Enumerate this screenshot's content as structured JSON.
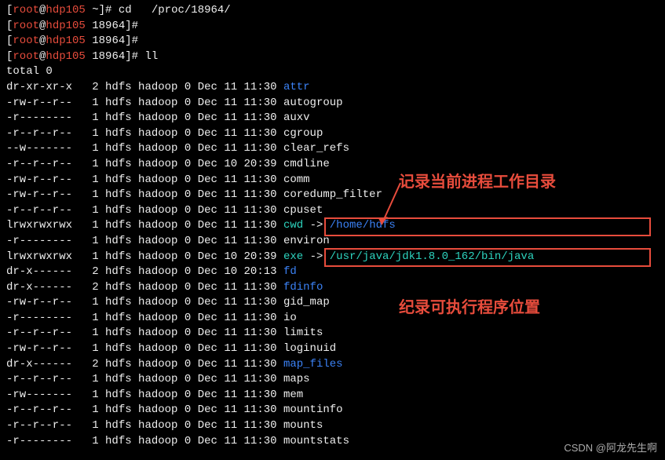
{
  "prompt": {
    "user": "root",
    "host": "hdp105",
    "cwd1": "~",
    "cwd2": "18964",
    "cmd1": "cd   /proc/18964/",
    "cmd2": "ll",
    "total": "total 0"
  },
  "annotation1": "记录当前进程工作目录",
  "annotation2": "纪录可执行程序位置",
  "watermark": "CSDN @阿龙先生啊",
  "rows": [
    {
      "perm": "dr-xr-xr-x",
      "link": "2",
      "u": "hdfs",
      "g": "hadoop",
      "sz": "0",
      "m": "Dec",
      "d": "11",
      "t": "11:30",
      "name": "attr",
      "cls": "blue"
    },
    {
      "perm": "-rw-r--r--",
      "link": "1",
      "u": "hdfs",
      "g": "hadoop",
      "sz": "0",
      "m": "Dec",
      "d": "11",
      "t": "11:30",
      "name": "autogroup",
      "cls": "white"
    },
    {
      "perm": "-r--------",
      "link": "1",
      "u": "hdfs",
      "g": "hadoop",
      "sz": "0",
      "m": "Dec",
      "d": "11",
      "t": "11:30",
      "name": "auxv",
      "cls": "white"
    },
    {
      "perm": "-r--r--r--",
      "link": "1",
      "u": "hdfs",
      "g": "hadoop",
      "sz": "0",
      "m": "Dec",
      "d": "11",
      "t": "11:30",
      "name": "cgroup",
      "cls": "white"
    },
    {
      "perm": "--w-------",
      "link": "1",
      "u": "hdfs",
      "g": "hadoop",
      "sz": "0",
      "m": "Dec",
      "d": "11",
      "t": "11:30",
      "name": "clear_refs",
      "cls": "white"
    },
    {
      "perm": "-r--r--r--",
      "link": "1",
      "u": "hdfs",
      "g": "hadoop",
      "sz": "0",
      "m": "Dec",
      "d": "10",
      "t": "20:39",
      "name": "cmdline",
      "cls": "white"
    },
    {
      "perm": "-rw-r--r--",
      "link": "1",
      "u": "hdfs",
      "g": "hadoop",
      "sz": "0",
      "m": "Dec",
      "d": "11",
      "t": "11:30",
      "name": "comm",
      "cls": "white"
    },
    {
      "perm": "-rw-r--r--",
      "link": "1",
      "u": "hdfs",
      "g": "hadoop",
      "sz": "0",
      "m": "Dec",
      "d": "11",
      "t": "11:30",
      "name": "coredump_filter",
      "cls": "white"
    },
    {
      "perm": "-r--r--r--",
      "link": "1",
      "u": "hdfs",
      "g": "hadoop",
      "sz": "0",
      "m": "Dec",
      "d": "11",
      "t": "11:30",
      "name": "cpuset",
      "cls": "white"
    },
    {
      "perm": "lrwxrwxrwx",
      "link": "1",
      "u": "hdfs",
      "g": "hadoop",
      "sz": "0",
      "m": "Dec",
      "d": "11",
      "t": "11:30",
      "name": "cwd",
      "cls": "cyan",
      "arrow": " -> ",
      "target": "/home/hdfs",
      "tcls": "blue"
    },
    {
      "perm": "-r--------",
      "link": "1",
      "u": "hdfs",
      "g": "hadoop",
      "sz": "0",
      "m": "Dec",
      "d": "11",
      "t": "11:30",
      "name": "environ",
      "cls": "white"
    },
    {
      "perm": "lrwxrwxrwx",
      "link": "1",
      "u": "hdfs",
      "g": "hadoop",
      "sz": "0",
      "m": "Dec",
      "d": "10",
      "t": "20:39",
      "name": "exe",
      "cls": "cyan",
      "arrow": " -> ",
      "target": "/usr/java/jdk1.8.0_162/bin/java",
      "tcls": "cyan"
    },
    {
      "perm": "dr-x------",
      "link": "2",
      "u": "hdfs",
      "g": "hadoop",
      "sz": "0",
      "m": "Dec",
      "d": "10",
      "t": "20:13",
      "name": "fd",
      "cls": "blue"
    },
    {
      "perm": "dr-x------",
      "link": "2",
      "u": "hdfs",
      "g": "hadoop",
      "sz": "0",
      "m": "Dec",
      "d": "11",
      "t": "11:30",
      "name": "fdinfo",
      "cls": "blue"
    },
    {
      "perm": "-rw-r--r--",
      "link": "1",
      "u": "hdfs",
      "g": "hadoop",
      "sz": "0",
      "m": "Dec",
      "d": "11",
      "t": "11:30",
      "name": "gid_map",
      "cls": "white"
    },
    {
      "perm": "-r--------",
      "link": "1",
      "u": "hdfs",
      "g": "hadoop",
      "sz": "0",
      "m": "Dec",
      "d": "11",
      "t": "11:30",
      "name": "io",
      "cls": "white"
    },
    {
      "perm": "-r--r--r--",
      "link": "1",
      "u": "hdfs",
      "g": "hadoop",
      "sz": "0",
      "m": "Dec",
      "d": "11",
      "t": "11:30",
      "name": "limits",
      "cls": "white"
    },
    {
      "perm": "-rw-r--r--",
      "link": "1",
      "u": "hdfs",
      "g": "hadoop",
      "sz": "0",
      "m": "Dec",
      "d": "11",
      "t": "11:30",
      "name": "loginuid",
      "cls": "white"
    },
    {
      "perm": "dr-x------",
      "link": "2",
      "u": "hdfs",
      "g": "hadoop",
      "sz": "0",
      "m": "Dec",
      "d": "11",
      "t": "11:30",
      "name": "map_files",
      "cls": "blue"
    },
    {
      "perm": "-r--r--r--",
      "link": "1",
      "u": "hdfs",
      "g": "hadoop",
      "sz": "0",
      "m": "Dec",
      "d": "11",
      "t": "11:30",
      "name": "maps",
      "cls": "white"
    },
    {
      "perm": "-rw-------",
      "link": "1",
      "u": "hdfs",
      "g": "hadoop",
      "sz": "0",
      "m": "Dec",
      "d": "11",
      "t": "11:30",
      "name": "mem",
      "cls": "white"
    },
    {
      "perm": "-r--r--r--",
      "link": "1",
      "u": "hdfs",
      "g": "hadoop",
      "sz": "0",
      "m": "Dec",
      "d": "11",
      "t": "11:30",
      "name": "mountinfo",
      "cls": "white"
    },
    {
      "perm": "-r--r--r--",
      "link": "1",
      "u": "hdfs",
      "g": "hadoop",
      "sz": "0",
      "m": "Dec",
      "d": "11",
      "t": "11:30",
      "name": "mounts",
      "cls": "white"
    },
    {
      "perm": "-r--------",
      "link": "1",
      "u": "hdfs",
      "g": "hadoop",
      "sz": "0",
      "m": "Dec",
      "d": "11",
      "t": "11:30",
      "name": "mountstats",
      "cls": "white"
    }
  ]
}
